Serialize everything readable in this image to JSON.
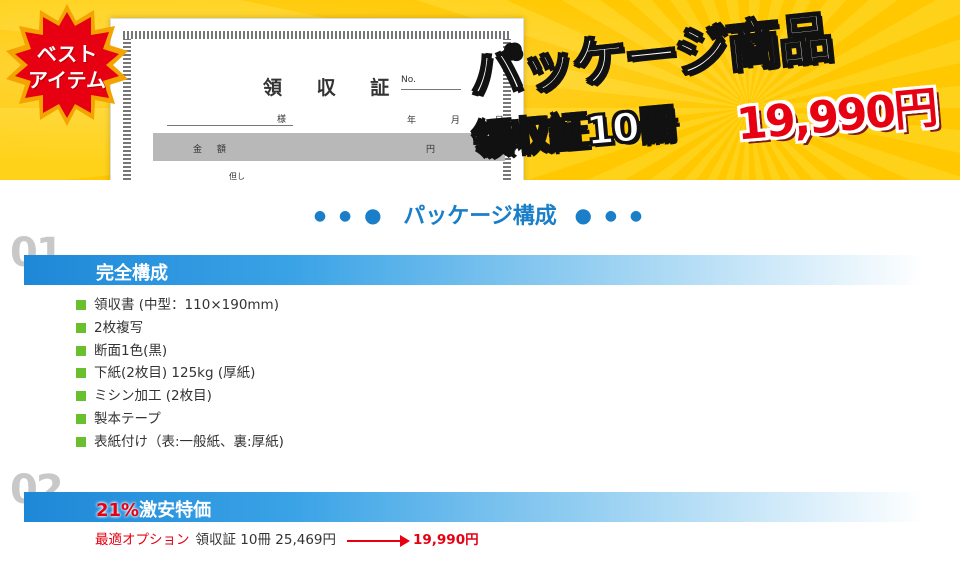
{
  "banner": {
    "badge": {
      "line1": "ベスト",
      "line2": "アイテム"
    },
    "headline": "パッケージ商品",
    "subhead": "領収証10冊",
    "price": "19,990円",
    "receipt_image": {
      "title": "領 収 証",
      "no": "No.",
      "sama": "様",
      "date": "年 月 日",
      "kingaku": "金 額",
      "en": "円",
      "tadashi": "但し"
    }
  },
  "package_title": "パッケージ構成",
  "sections": [
    {
      "num": "01",
      "label": "完全構成",
      "items": [
        "領収書 (中型：110×190mm)",
        "2枚複写",
        "断面1色(黒)",
        "下紙(2枚目) 125kg (厚紙)",
        "ミシン加工 (2枚目)",
        "製本テープ",
        "表紙付け（表:一般紙、裏:厚紙)"
      ]
    },
    {
      "num": "02",
      "label_red": "21%",
      "label_rest": "激安特価",
      "option_label": "最適オプション",
      "option_text": "領収証 10冊 25,469円",
      "option_price": "19,990円"
    }
  ],
  "colors": {
    "accent_blue": "#1a7fc8",
    "accent_red": "#e60012",
    "bullet_green": "#6abf2e",
    "banner_yellow": "#ffc800"
  }
}
